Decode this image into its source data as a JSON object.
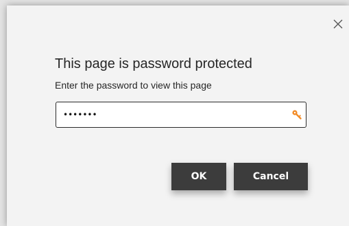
{
  "dialog": {
    "title": "This page is password protected",
    "subtitle": "Enter the password to view this page",
    "close_icon": "close-icon",
    "password": {
      "value": "•••••••",
      "icon": "key-icon",
      "icon_color": "#f28c28"
    },
    "buttons": {
      "ok_label": "OK",
      "cancel_label": "Cancel"
    },
    "colors": {
      "background": "#f3f3f3",
      "button_background": "#3c3c3c",
      "button_text": "#ffffff",
      "text": "#262626"
    }
  }
}
